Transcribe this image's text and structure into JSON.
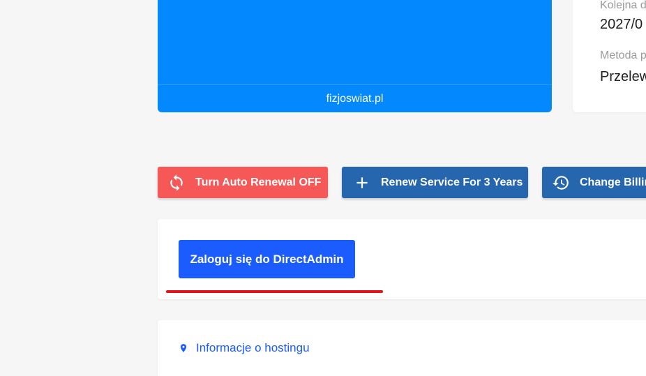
{
  "service_card": {
    "domain": "fizjoswiat.pl"
  },
  "info_card": {
    "next_label": "Kolejna d",
    "next_value": "2027/0",
    "payment_label": "Metoda p",
    "payment_value": "Przelew"
  },
  "actions": {
    "auto_renewal": "Turn Auto Renewal OFF",
    "renew": "Renew Service For 3 Years",
    "change_billing": "Change Billin"
  },
  "login": {
    "button_label": "Zaloguj się do DirectAdmin"
  },
  "hosting": {
    "link_label": "Informacje o hostingu"
  },
  "colors": {
    "service_card": "#0389fd",
    "auto_renewal_button": "#f65757",
    "action_button": "#2566ae",
    "login_button": "#1b5cff",
    "underline": "#e1141a",
    "link": "#1b5cff"
  },
  "icons": {
    "auto_renewal": "refresh-icon",
    "renew": "plus-icon",
    "change_billing": "history-icon",
    "hosting": "location-pin-icon"
  }
}
